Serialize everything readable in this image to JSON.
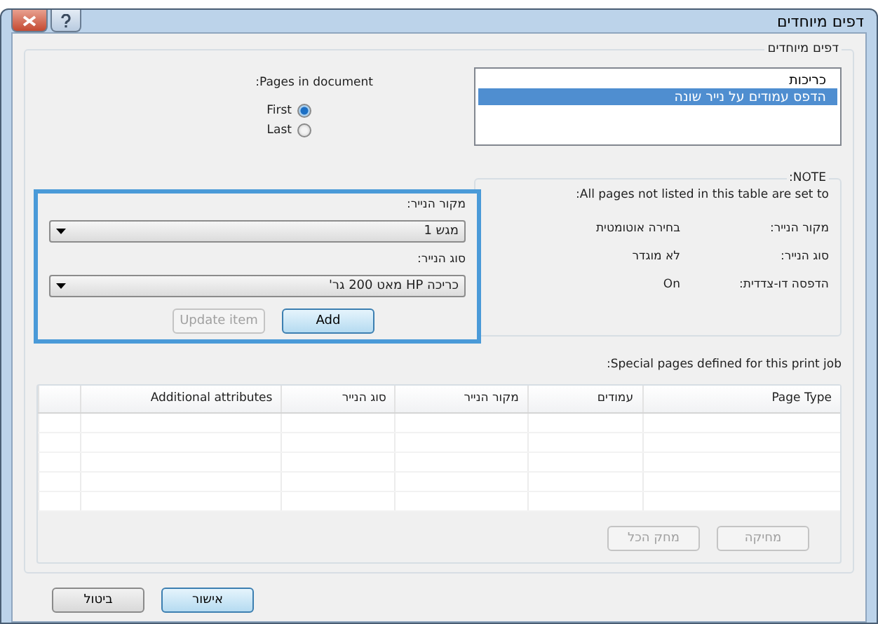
{
  "window": {
    "title": "דפים מיוחדים"
  },
  "group_title": "דפים מיוחדים",
  "page_types": [
    {
      "label": "כריכות",
      "selected": false
    },
    {
      "label": "הדפס עמודים על נייר שונה",
      "selected": true
    }
  ],
  "pages_in_document": {
    "label": "Pages in document:",
    "options": [
      {
        "label": "First",
        "selected": true
      },
      {
        "label": "Last",
        "selected": false
      }
    ]
  },
  "note": {
    "title": "NOTE:",
    "intro": "All pages not listed in this table are set to:",
    "rows": [
      {
        "label": "מקור הנייר:",
        "value": "בחירה אוטומטית"
      },
      {
        "label": "סוג הנייר:",
        "value": "לא מוגדר"
      },
      {
        "label": "הדפסה דו-צדדית:",
        "value": "On"
      }
    ]
  },
  "editor": {
    "fields": [
      {
        "label": "מקור הנייר:",
        "value": "מגש 1"
      },
      {
        "label": "סוג הנייר:",
        "value": "כריכה HP מאט 200 גר'"
      }
    ],
    "buttons": [
      {
        "label": "Add",
        "disabled": false,
        "default": true
      },
      {
        "label": "Update item",
        "disabled": true,
        "default": false
      }
    ]
  },
  "special_pages": {
    "label": "Special pages defined for this print job:",
    "columns": [
      "Page Type",
      "עמודים",
      "מקור הנייר",
      "סוג הנייר",
      "Additional attributes"
    ],
    "buttons": [
      {
        "label": "מחיקה",
        "disabled": true
      },
      {
        "label": "מחק הכל",
        "disabled": true
      }
    ]
  },
  "buttons": [
    {
      "label": "אישור",
      "default": true
    },
    {
      "label": "ביטול",
      "default": false
    }
  ]
}
